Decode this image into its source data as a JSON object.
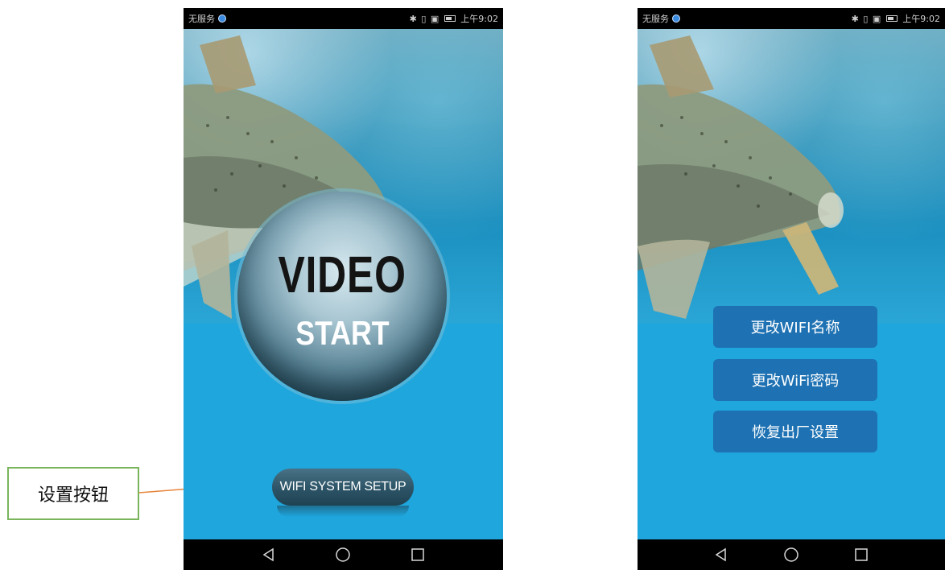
{
  "callout": {
    "label": "设置按钮"
  },
  "left_phone": {
    "status": {
      "carrier": "无服务",
      "icons": "✱ ▯ ▣",
      "time": "上午9:02"
    },
    "video_button": {
      "title": "VIDEO",
      "subtitle": "START"
    },
    "setup_button": {
      "label": "WIFI SYSTEM SETUP"
    }
  },
  "right_phone": {
    "status": {
      "carrier": "无服务",
      "icons": "✱ ▯ ▣",
      "time": "上午9:02"
    },
    "menu": [
      {
        "label": "更改WIFI名称"
      },
      {
        "label": "更改WiFi密码"
      },
      {
        "label": "恢复出厂设置"
      }
    ]
  },
  "colors": {
    "arrow": "#e8843a",
    "callout_border": "#7ab55c",
    "menu_button": "#1e72b3",
    "lower_background": "#1ea6dd"
  },
  "icons": {
    "nav": [
      "back-triangle-icon",
      "home-circle-icon",
      "recents-square-icon"
    ]
  }
}
